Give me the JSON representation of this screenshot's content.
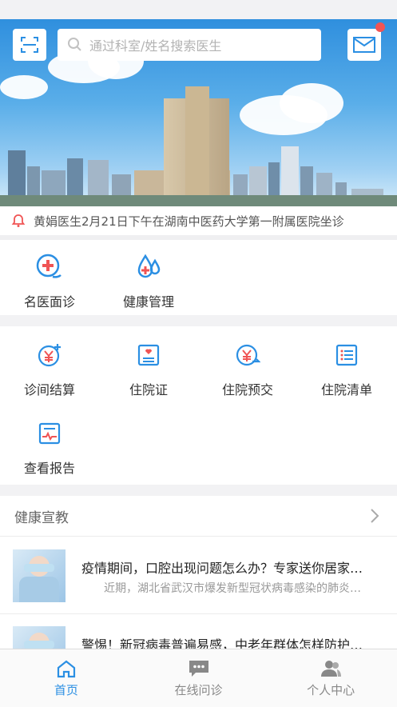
{
  "header": {
    "search_placeholder": "通过科室/姓名搜索医生",
    "scan_icon": "scan-icon",
    "mail_icon": "mail-icon"
  },
  "notice": {
    "text": "黄娟医生2月21日下午在湖南中医药大学第一附属医院坐诊"
  },
  "main_services": [
    {
      "label": "名医面诊",
      "icon": "doctor-consult-icon"
    },
    {
      "label": "健康管理",
      "icon": "health-drops-icon"
    }
  ],
  "services": [
    {
      "label": "诊间结算",
      "icon": "yuan-plus-icon"
    },
    {
      "label": "住院证",
      "icon": "hospital-card-icon"
    },
    {
      "label": "住院预交",
      "icon": "yuan-transfer-icon"
    },
    {
      "label": "住院清单",
      "icon": "list-icon"
    },
    {
      "label": "查看报告",
      "icon": "report-icon"
    }
  ],
  "health_edu": {
    "title": "健康宣教",
    "articles": [
      {
        "title": "疫情期间，口腔出现问题怎么办？专家送你居家…",
        "summary": "近期，湖北省武汉市爆发新型冠状病毒感染的肺炎…"
      },
      {
        "title": "警惕！新冠病毒普遍易感，中老年群体怎样防护…",
        "summary": ""
      }
    ]
  },
  "tabbar": {
    "items": [
      {
        "label": "首页",
        "icon": "home-icon",
        "active": true
      },
      {
        "label": "在线问诊",
        "icon": "chat-icon",
        "active": false
      },
      {
        "label": "个人中心",
        "icon": "user-icon",
        "active": false
      }
    ]
  },
  "colors": {
    "accent": "#2b8fe3",
    "alert": "#f05454",
    "inactive": "#888888"
  }
}
